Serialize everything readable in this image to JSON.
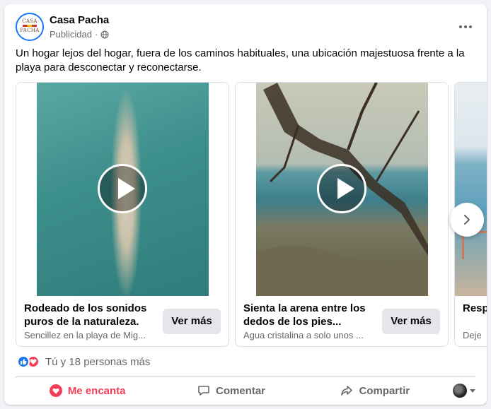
{
  "post": {
    "page_name": "Casa Pacha",
    "sponsored_label": "Publicidad",
    "separator": "·",
    "privacy_icon": "globe-icon",
    "caption": "Un hogar lejos del hogar, fuera de los caminos habituales, una ubicación majestuosa frente a la playa para desconectar y reconectarse.",
    "avatar_text": [
      "CASA",
      "PACHA"
    ]
  },
  "carousel": {
    "cards": [
      {
        "title": "Rodeado de los sonidos puros de la naturaleza.",
        "subtitle": "Sencillez en la playa de Mig...",
        "cta": "Ver más",
        "media_icon": "play-icon"
      },
      {
        "title": "Sienta la arena entre los dedos de los pies...",
        "subtitle": "Agua cristalina a solo unos ...",
        "cta": "Ver más",
        "media_icon": "play-icon"
      },
      {
        "title": "Resp ojos",
        "subtitle": "Deje"
      }
    ],
    "next_icon": "chevron-right-icon"
  },
  "reactions": {
    "icons": [
      "like-icon",
      "love-icon"
    ],
    "summary": "Tú y 18 personas más"
  },
  "actions": {
    "love": "Me encanta",
    "comment": "Comentar",
    "share": "Compartir"
  },
  "colors": {
    "brand_blue": "#1877f2",
    "love_red": "#f33e58",
    "secondary_text": "#65676b"
  }
}
